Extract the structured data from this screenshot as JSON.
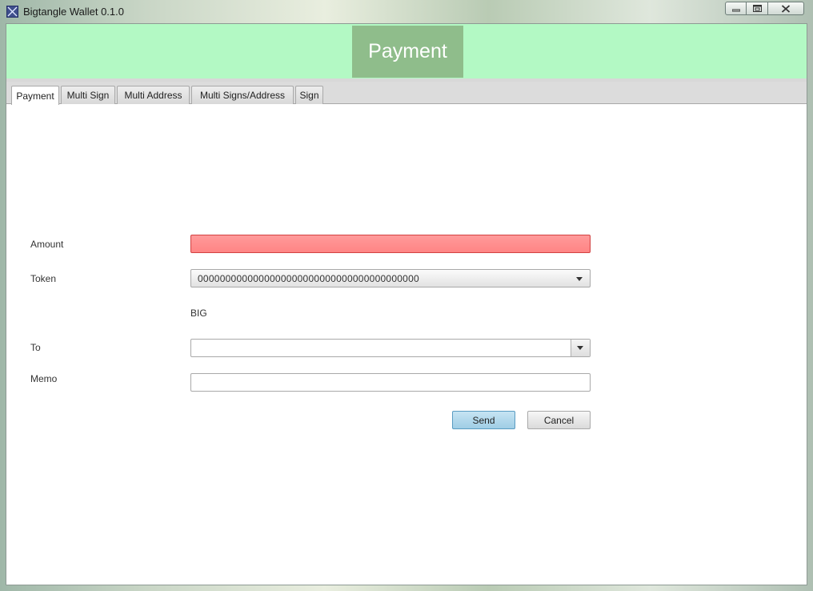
{
  "window": {
    "title": "Bigtangle  Wallet 0.1.0"
  },
  "banner": {
    "title": "Payment"
  },
  "tabs": [
    {
      "label": "Payment",
      "active": true
    },
    {
      "label": "Multi Sign",
      "active": false
    },
    {
      "label": "Multi Address",
      "active": false
    },
    {
      "label": "Multi Signs/Address",
      "active": false
    },
    {
      "label": "Sign",
      "active": false
    }
  ],
  "form": {
    "amount_label": "Amount",
    "amount_value": "",
    "token_label": "Token",
    "token_value": "0000000000000000000000000000000000000000",
    "token_name": "BIG",
    "to_label": "To",
    "to_value": "",
    "memo_label": "Memo",
    "memo_value": "",
    "send_label": "Send",
    "cancel_label": "Cancel"
  },
  "colors": {
    "banner_bg": "#b3f9c4",
    "banner_title_bg": "#8fbd8b",
    "amount_invalid_bg": "#ff8f8f",
    "send_button_bg": "#b3d9ee"
  }
}
